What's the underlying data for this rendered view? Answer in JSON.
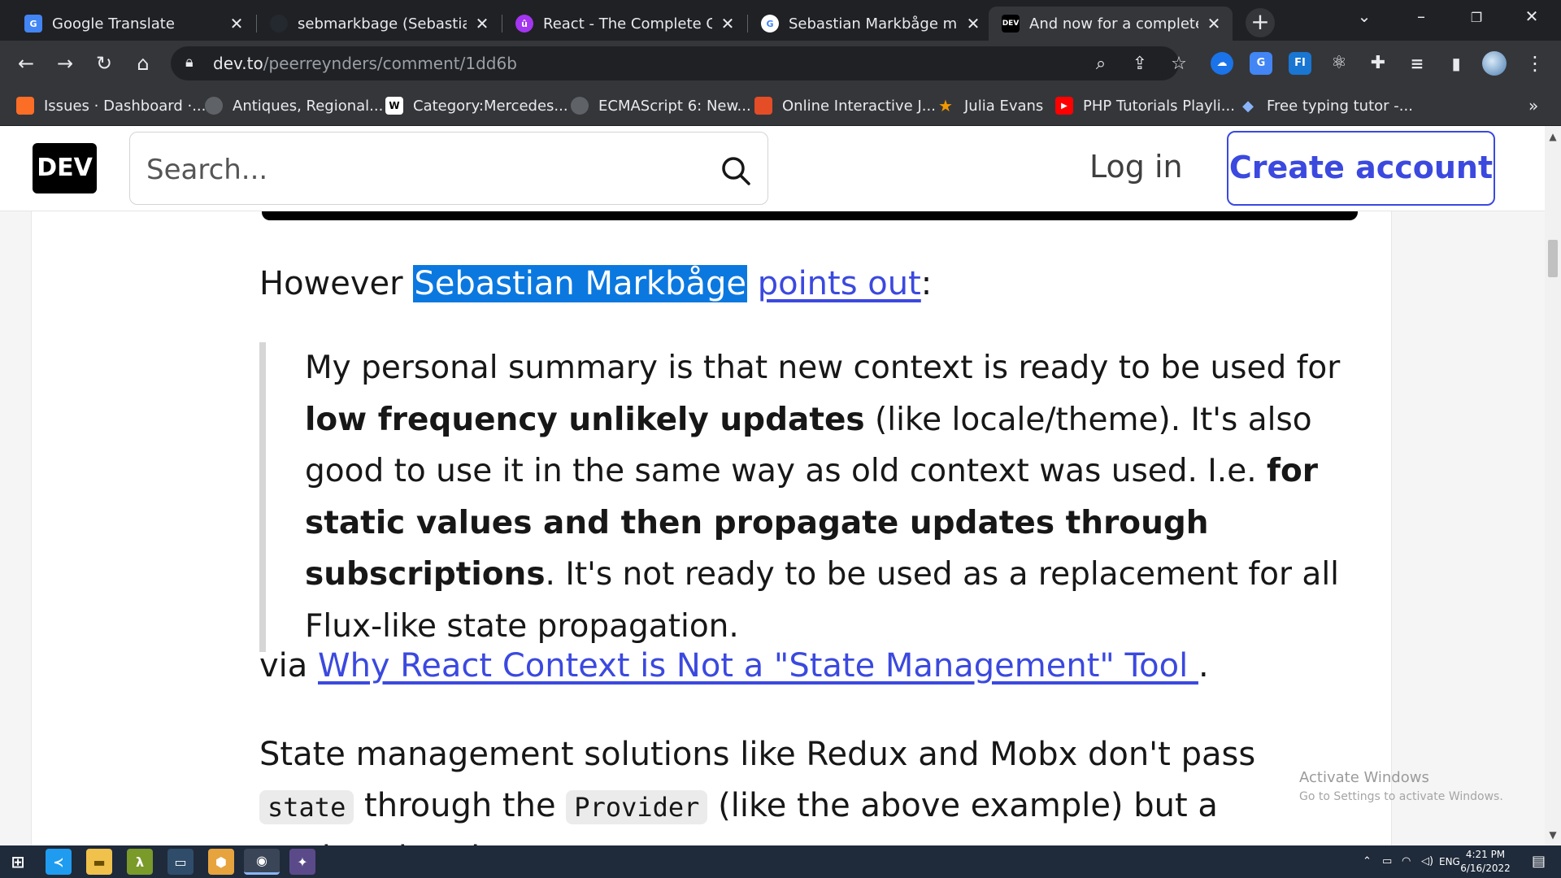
{
  "tabs": [
    {
      "title": "Google Translate",
      "icon": "google-translate-icon",
      "color": "#4285f4"
    },
    {
      "title": "sebmarkbage (Sebastian M",
      "icon": "github-icon",
      "color": "#24292f"
    },
    {
      "title": "React - The Complete Gui",
      "icon": "udemy-icon",
      "color": "#a435f0"
    },
    {
      "title": "Sebastian Markbåge my p",
      "icon": "google-icon",
      "color": "#ffffff"
    },
    {
      "title": "And now for a completely",
      "icon": "dev-icon",
      "color": "#000000"
    }
  ],
  "toolbar": {
    "url_domain": "dev.to",
    "url_path": "/peerreynders/comment/1dd6b"
  },
  "bookmarks": [
    {
      "label": "Issues · Dashboard ·...",
      "icon": "gitlab-icon",
      "color": "#fc6d26"
    },
    {
      "label": "Antiques, Regional...",
      "icon": "globe-icon",
      "color": "#5f6368"
    },
    {
      "label": "Category:Mercedes...",
      "icon": "wikipedia-icon",
      "color": "#ffffff"
    },
    {
      "label": "ECMAScript 6: New...",
      "icon": "globe-icon",
      "color": "#5f6368"
    },
    {
      "label": "Online Interactive J...",
      "icon": "html5-icon",
      "color": "#e44d26"
    },
    {
      "label": "Julia Evans",
      "icon": "star-icon",
      "color": "#f29900"
    },
    {
      "label": "PHP Tutorials Playli...",
      "icon": "youtube-icon",
      "color": "#ff0000"
    },
    {
      "label": "Free typing tutor -...",
      "icon": "typing-icon",
      "color": "#8ab4f8"
    }
  ],
  "site": {
    "logo": "DEV",
    "search_placeholder": "Search...",
    "login": "Log in",
    "create_account": "Create account"
  },
  "article": {
    "p1_before": "However ",
    "p1_highlight": "Sebastian Markbåge",
    "p1_link": "points out",
    "p1_after": ":",
    "quote": {
      "t1": "My personal summary is that new context is ready to be used for ",
      "b1": "low frequency unlikely updates",
      "t2": " (like locale/theme). It's also good to use it in the same way as old context was used. I.e. ",
      "b2": "for static values and then propagate updates through subscriptions",
      "t3": ". It's not ready to be used as a replacement for all Flux-like state propagation."
    },
    "p2_before": "via ",
    "p2_link": "Why React Context is Not a \"State Management\" Tool ",
    "p2_after": ".",
    "p3_t1": "State management solutions like Redux and Mobx don't pass ",
    "p3_code1": "state",
    "p3_t2": " through the ",
    "p3_code2": "Provider",
    "p3_t3": " (like the above example) but a static value that"
  },
  "watermark": {
    "title": "Activate Windows",
    "subtitle": "Go to Settings to activate Windows."
  },
  "taskbar": {
    "lang": "ENG",
    "time": "4:21 PM",
    "date": "6/16/2022"
  },
  "colors": {
    "accent": "#3b49df",
    "highlight": "#0b78e0"
  }
}
